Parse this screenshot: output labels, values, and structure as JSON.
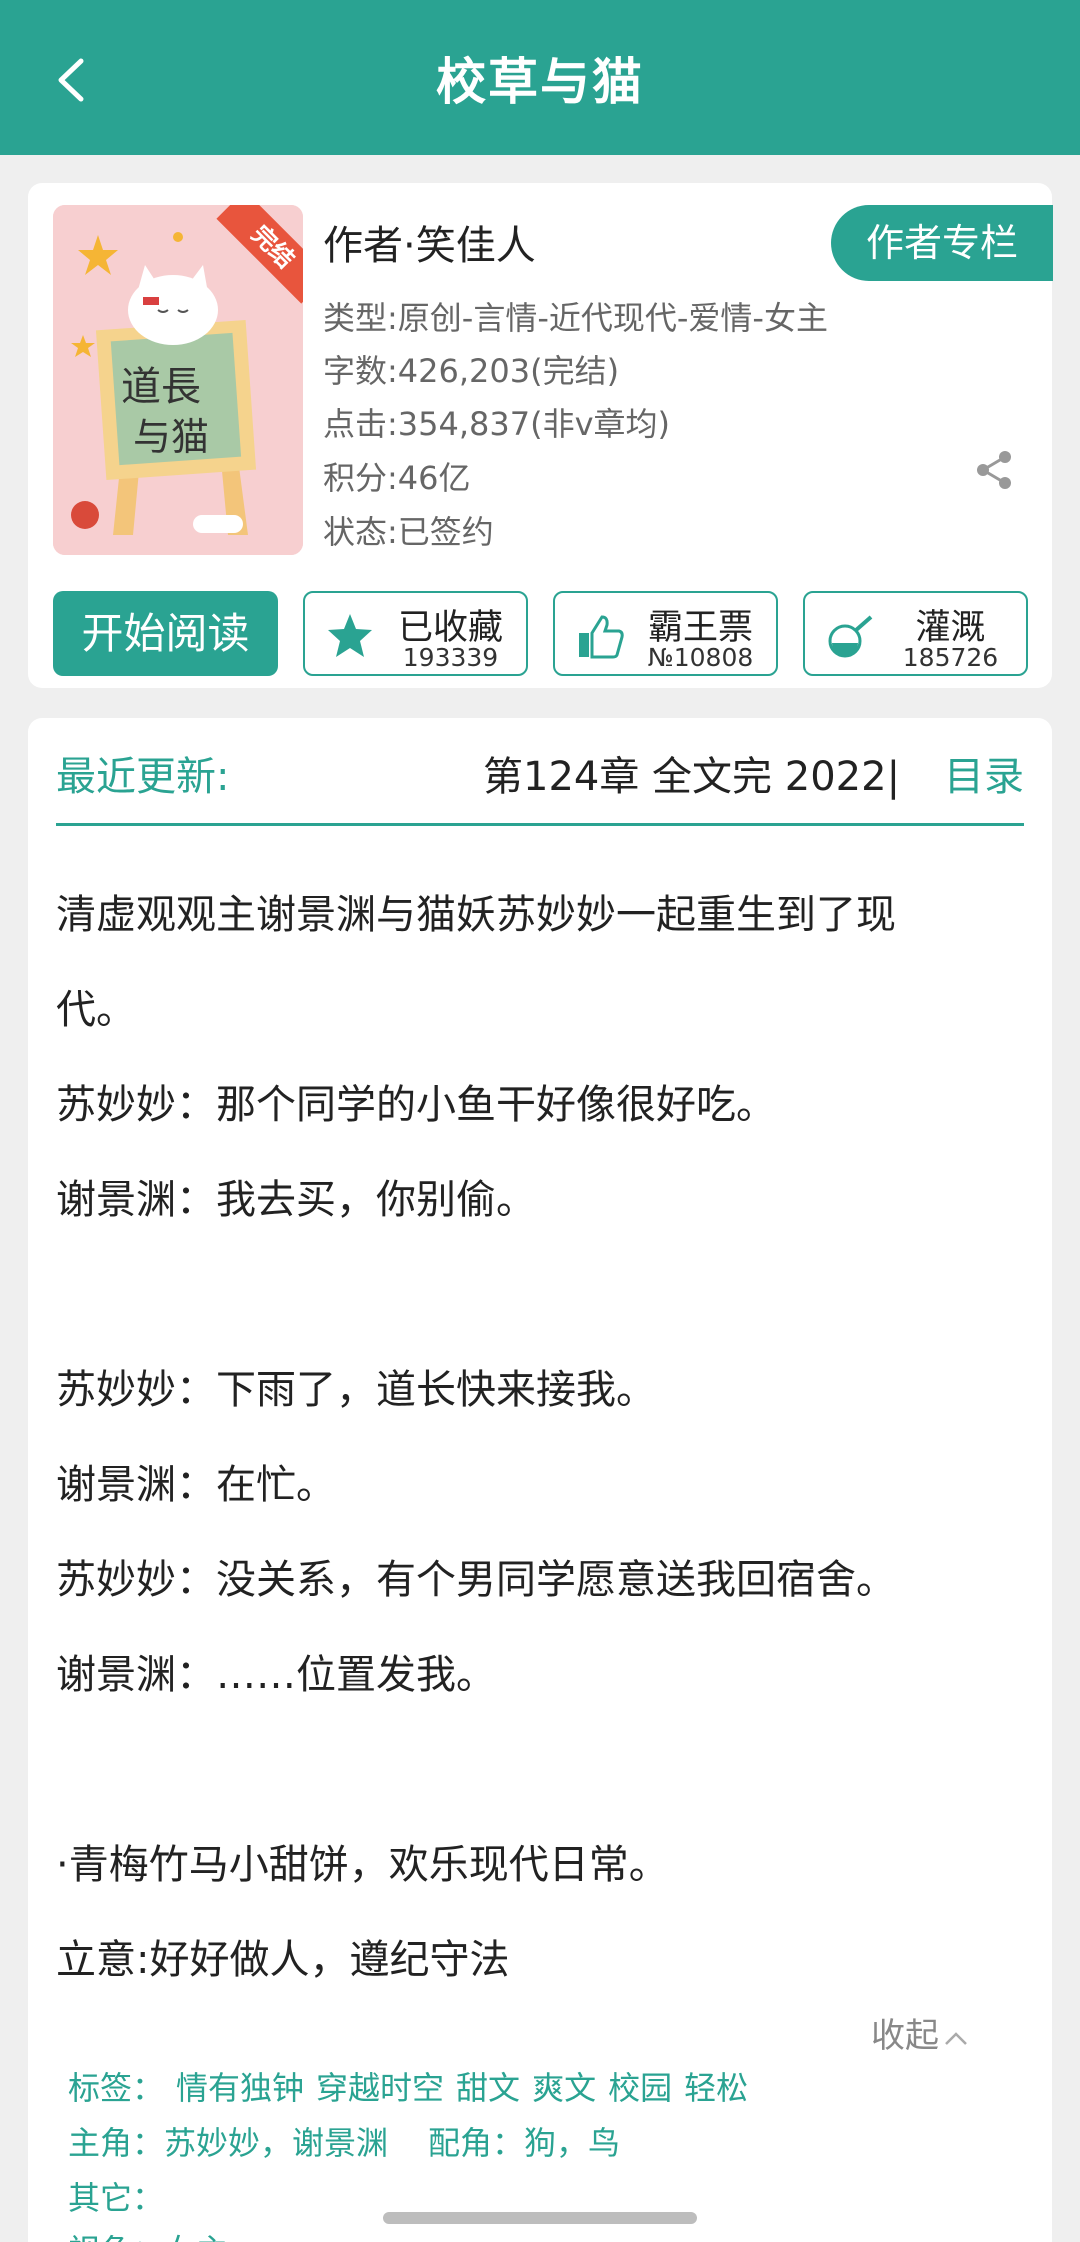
{
  "header": {
    "title": "校草与猫"
  },
  "book": {
    "ribbon": "完结",
    "author": "作者·笑佳人",
    "author_column_btn": "作者专栏",
    "type": "类型:原创-言情-近代现代-爱情-女主",
    "words": "字数:426,203(完结)",
    "clicks": "点击:354,837(非v章均)",
    "score": "积分:46亿",
    "status": "状态:已签约"
  },
  "actions": {
    "read": "开始阅读",
    "favorite": {
      "label": "已收藏",
      "count": "193339"
    },
    "vote": {
      "label": "霸王票",
      "count": "№10808"
    },
    "water": {
      "label": "灌溉",
      "count": "185726"
    }
  },
  "update": {
    "label": "最近更新:",
    "value": "第124章 全文完 2022|",
    "toc": "目录"
  },
  "summary": {
    "l1": "清虚观观主谢景渊与猫妖苏妙妙一起重生到了现",
    "l2": "代。",
    "l3": "苏妙妙：那个同学的小鱼干好像很好吃。",
    "l4": "谢景渊：我去买，你别偷。",
    "l5": "苏妙妙：下雨了，道长快来接我。",
    "l6": "谢景渊：在忙。",
    "l7": "苏妙妙：没关系，有个男同学愿意送我回宿舍。",
    "l8": "谢景渊：……位置发我。",
    "l9": "·青梅竹马小甜饼，欢乐现代日常。",
    "l10": "立意:好好做人，遵纪守法"
  },
  "collapse": "收起",
  "tags": {
    "label": "标签：",
    "items": [
      "情有独钟",
      "穿越时空",
      "甜文",
      "爽文",
      "校园",
      "轻松"
    ]
  },
  "roles": {
    "main_label": "主角：",
    "main": "苏妙妙，谢景渊",
    "support_label": "配角：",
    "support": "狗，鸟"
  },
  "other": {
    "label": "其它："
  },
  "perspective": {
    "label": "视角：",
    "value": "女主"
  },
  "colors": {
    "accent": "#2aa392",
    "ribbon": "#e8553d"
  }
}
